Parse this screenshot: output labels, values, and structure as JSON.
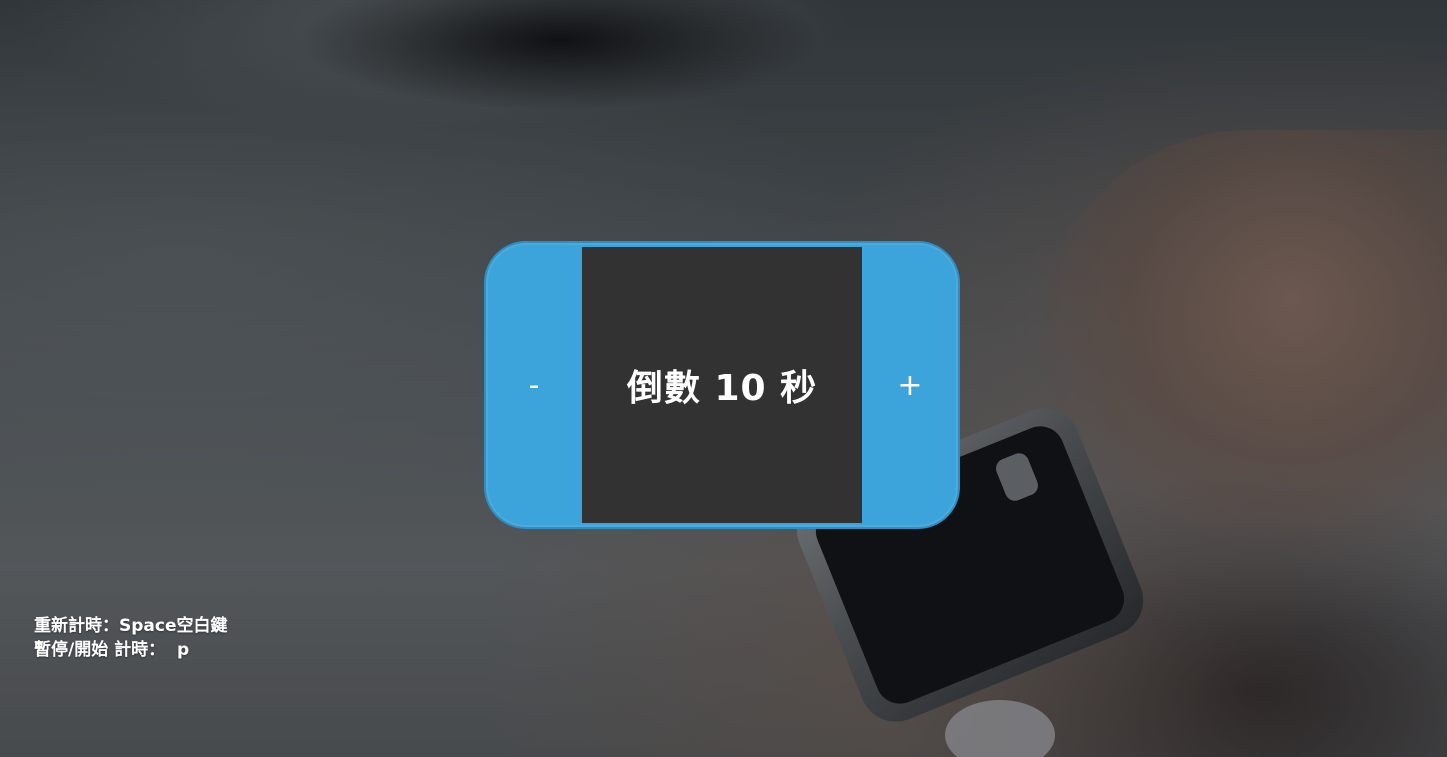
{
  "timer": {
    "decrement_label": "-",
    "increment_label": "+",
    "display_text": "倒數 10 秒"
  },
  "help": {
    "restart_hint": "重新計時：Space空白鍵",
    "pause_hint": "暫停/開始 計時：  p"
  },
  "colors": {
    "widget_blue": "#3ca4db",
    "display_bg": "#323232",
    "text": "#ffffff"
  }
}
